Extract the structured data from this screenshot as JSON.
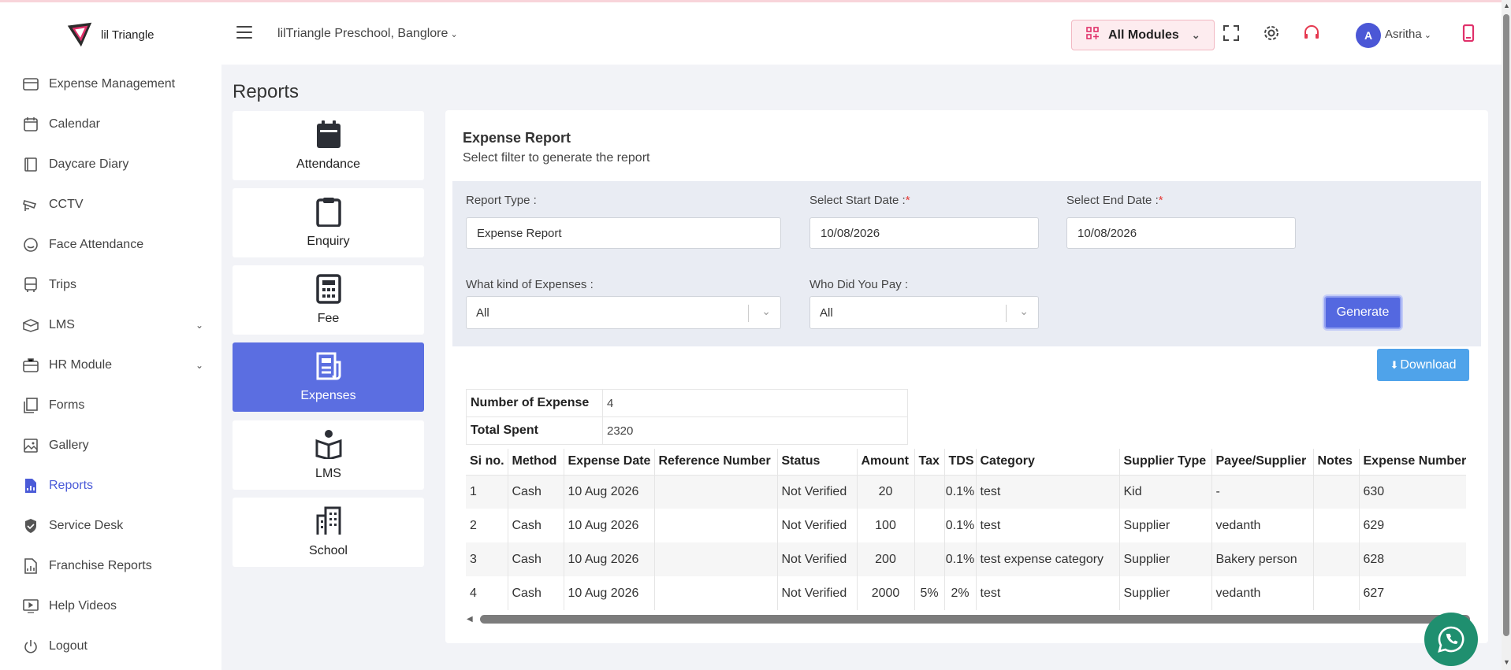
{
  "header": {
    "logo_text": "lil Triangle",
    "school": "lilTriangle Preschool, Banglore",
    "modules_label": "All Modules",
    "username": "Asritha",
    "avatar_letter": "A"
  },
  "sidebar": {
    "items": [
      {
        "label": "Expense Management",
        "icon": "wallet-icon"
      },
      {
        "label": "Calendar",
        "icon": "calendar-icon"
      },
      {
        "label": "Daycare Diary",
        "icon": "diary-icon"
      },
      {
        "label": "CCTV",
        "icon": "cctv-icon"
      },
      {
        "label": "Face Attendance",
        "icon": "face-icon"
      },
      {
        "label": "Trips",
        "icon": "bus-icon"
      },
      {
        "label": "LMS",
        "icon": "lms-icon"
      },
      {
        "label": "HR Module",
        "icon": "briefcase-icon"
      },
      {
        "label": "Forms",
        "icon": "forms-icon"
      },
      {
        "label": "Gallery",
        "icon": "gallery-icon"
      },
      {
        "label": "Reports",
        "icon": "reports-icon"
      },
      {
        "label": "Service Desk",
        "icon": "shield-icon"
      },
      {
        "label": "Franchise Reports",
        "icon": "franchise-reports-icon"
      },
      {
        "label": "Help Videos",
        "icon": "video-icon"
      },
      {
        "label": "Logout",
        "icon": "power-icon"
      }
    ]
  },
  "page": {
    "title": "Reports"
  },
  "categories": [
    {
      "label": "Attendance",
      "icon": "calendar-icon"
    },
    {
      "label": "Enquiry",
      "icon": "clipboard-icon"
    },
    {
      "label": "Fee",
      "icon": "calculator-icon"
    },
    {
      "label": "Expenses",
      "icon": "receipt-icon"
    },
    {
      "label": "LMS",
      "icon": "book-reader-icon"
    },
    {
      "label": "School",
      "icon": "building-icon"
    }
  ],
  "report": {
    "title": "Expense Report",
    "subtitle": "Select filter to generate the report",
    "report_type_label": "Report Type :",
    "report_type_value": "Expense Report",
    "start_label": "Select Start Date :",
    "start_value": "10/08/2026",
    "end_label": "Select End Date :",
    "end_value": "10/08/2026",
    "required_mark": "*",
    "expense_kind_label": "What kind of Expenses :",
    "expense_kind_value": "All",
    "payee_label": "Who Did You Pay :",
    "payee_value": "All",
    "generate_label": "Generate",
    "download_label": "Download"
  },
  "summary": {
    "count_label": "Number of Expense",
    "count_value": "4",
    "total_label": "Total Spent",
    "total_value": "2320"
  },
  "table": {
    "headers": [
      "Si no.",
      "Method",
      "Expense Date",
      "Reference Number",
      "Status",
      "Amount",
      "Tax",
      "TDS",
      "Category",
      "Supplier Type",
      "Payee/Supplier",
      "Notes",
      "Expense Number"
    ],
    "rows": [
      [
        "1",
        "Cash",
        "10 Aug 2026",
        "",
        "Not Verified",
        "20",
        "",
        "0.1%",
        "test",
        "Kid",
        "-",
        "",
        "630"
      ],
      [
        "2",
        "Cash",
        "10 Aug 2026",
        "",
        "Not Verified",
        "100",
        "",
        "0.1%",
        "test",
        "Supplier",
        "vedanth",
        "",
        "629"
      ],
      [
        "3",
        "Cash",
        "10 Aug 2026",
        "",
        "Not Verified",
        "200",
        "",
        "0.1%",
        "test expense category",
        "Supplier",
        "Bakery person",
        "",
        "628"
      ],
      [
        "4",
        "Cash",
        "10 Aug 2026",
        "",
        "Not Verified",
        "2000",
        "5%",
        "2%",
        "test",
        "Supplier",
        "vedanth",
        "",
        "627"
      ]
    ]
  },
  "colors": {
    "accent": "#5b6ee1",
    "brand_pink": "#e0306a",
    "download": "#4fa3ea",
    "whatsapp": "#1f8f6f"
  }
}
